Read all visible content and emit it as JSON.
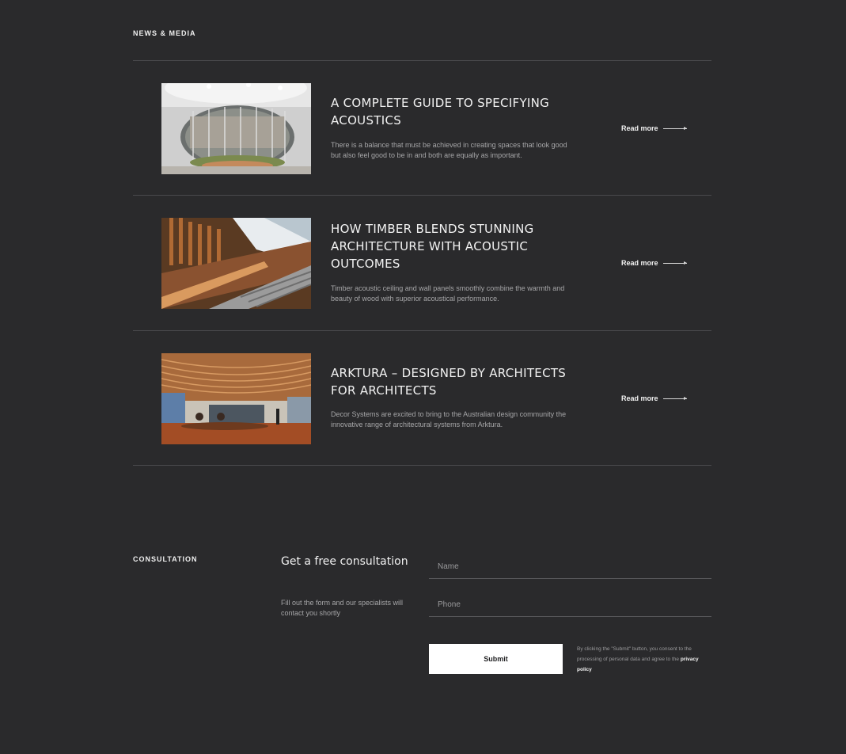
{
  "news": {
    "section_label": "NEWS & MEDIA",
    "items": [
      {
        "title": "A COMPLETE GUIDE TO SPECIFYING ACOUSTICS",
        "description": "There is a balance that must be achieved in creating spaces that look good but also feel good to be in and both are equally as important.",
        "read_more": "Read more",
        "image": "round-glass-atrium-photo"
      },
      {
        "title": "HOW TIMBER BLENDS STUNNING ARCHITECTURE WITH ACOUSTIC OUTCOMES",
        "description": "Timber acoustic ceiling and wall panels smoothly combine the warmth and beauty of wood with superior acoustical performance.",
        "read_more": "Read more",
        "image": "timber-staircase-photo"
      },
      {
        "title": "ARKTURA – DESIGNED BY ARCHITECTS FOR ARCHITECTS",
        "description": "Decor Systems are excited to bring to the Australian design community the innovative range of architectural systems from Arktura.",
        "read_more": "Read more",
        "image": "wave-timber-ceiling-photo"
      }
    ]
  },
  "consultation": {
    "section_label": "CONSULTATION",
    "heading": "Get a free consultation",
    "subtext": "Fill out the form and our specialists will contact you shortly",
    "name_placeholder": "Name",
    "phone_placeholder": "Phone",
    "submit_label": "Submit",
    "consent_text": "By clicking the \"Submit\" button, you consent to the processing of personal data and agree to the",
    "privacy_link": "privacy policy"
  },
  "colors": {
    "background": "#2a2a2c",
    "divider": "#4a4a4d",
    "button_bg": "#ffffff"
  }
}
